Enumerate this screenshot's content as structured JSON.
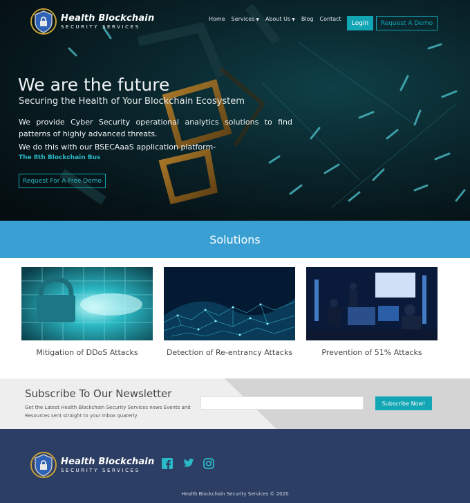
{
  "brand": {
    "name": "Health Blockchain",
    "tagline": "SECURITY SERVICES"
  },
  "nav": {
    "items": [
      {
        "label": "Home",
        "icon": ""
      },
      {
        "label": "Services",
        "icon": "caret-down-icon"
      },
      {
        "label": "About Us",
        "icon": "caret-down-icon"
      },
      {
        "label": "Blog",
        "icon": ""
      },
      {
        "label": "Contact",
        "icon": ""
      }
    ],
    "login_label": "Login",
    "demo_label": "Request A Demo"
  },
  "hero": {
    "title": "We are the future",
    "subtitle": "Securing the Health of Your Blockchain Ecosystem",
    "description": "We provide Cyber Security operational analytics solutions to find patterns of highly advanced threats.",
    "description2": "We do this with our  BSECAaaS application platform-",
    "link": "The 8th Blockchain Bus",
    "cta_label": "Request For A Free Demo"
  },
  "solutions": {
    "title": "Solutions",
    "cards": [
      {
        "label": "Mitigation of DDoS Attacks",
        "image": "padlock-image"
      },
      {
        "label": "Detection of Re-entrancy Attacks",
        "image": "network-mesh-image"
      },
      {
        "label": "Prevention of 51% Attacks",
        "image": "security-operations-room-image"
      }
    ]
  },
  "newsletter": {
    "title": "Subscribe To Our Newsletter",
    "text": "Get the Latest Health Blockchain Security Services news Events and Resources sent straight to your Inbox quaterly",
    "input_value": "",
    "button_label": "Subscribe Now!"
  },
  "footer": {
    "social": [
      "facebook-icon",
      "twitter-icon",
      "instagram-icon"
    ],
    "copyright": "Health Blockchain Security Services © 2020"
  },
  "colors": {
    "accent": "#13a6b4",
    "solutions_bar": "#3aa0d3",
    "footer": "#2c3e63"
  }
}
